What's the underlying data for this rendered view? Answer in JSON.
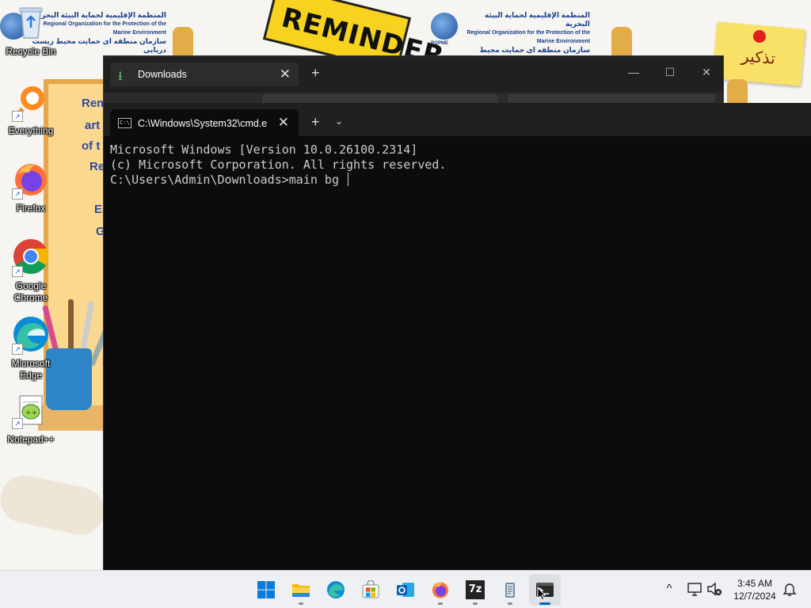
{
  "wallpaper": {
    "logo_text_line1": "المنظمة الإقليمية لحماية البيئة البحرية",
    "logo_text_line2": "Regional Organization for the Protection of the Marine Environment",
    "logo_text_line3": "سازمان منطقه ای حمایت محیط زیست دریایی",
    "logo_abbrev": "ROPME",
    "reminder_text": "REMINDER",
    "note_text": "تذكير",
    "board_lines": [
      "Rem",
      "art",
      "of t",
      "Re",
      "E",
      "G"
    ]
  },
  "desktop_icons": [
    {
      "label": "Recycle Bin",
      "icon": "recycle-bin-icon"
    },
    {
      "label": "Everything",
      "icon": "everything-search-icon"
    },
    {
      "label": "Firefox",
      "icon": "firefox-icon"
    },
    {
      "label": "Google Chrome",
      "icon": "chrome-icon"
    },
    {
      "label": "Microsoft Edge",
      "icon": "edge-icon"
    },
    {
      "label": "Notepad++",
      "icon": "notepad-plus-plus-icon"
    }
  ],
  "explorer": {
    "tab_label": "Downloads",
    "new_tab": "+",
    "minimize": "—",
    "maximize": "☐",
    "close": "✕"
  },
  "terminal": {
    "tab_label": "C:\\Windows\\System32\\cmd.e",
    "new_tab": "+",
    "dropdown": "⌄",
    "lines": [
      "Microsoft Windows [Version 10.0.26100.2314]",
      "(c) Microsoft Corporation. All rights reserved.",
      "",
      "C:\\Users\\Admin\\Downloads>main bg "
    ]
  },
  "taskbar": {
    "apps": [
      {
        "name": "Start",
        "icon": "windows-start-icon",
        "running": false
      },
      {
        "name": "File Explorer",
        "icon": "file-explorer-icon",
        "running": true
      },
      {
        "name": "Microsoft Edge",
        "icon": "edge-icon",
        "running": false
      },
      {
        "name": "Microsoft Store",
        "icon": "store-icon",
        "running": false
      },
      {
        "name": "Outlook",
        "icon": "outlook-icon",
        "running": false
      },
      {
        "name": "Firefox",
        "icon": "firefox-icon",
        "running": true
      },
      {
        "name": "7-Zip",
        "icon": "7zip-icon",
        "running": true
      },
      {
        "name": "Notepad",
        "icon": "notepad-icon",
        "running": true
      },
      {
        "name": "Terminal",
        "icon": "terminal-icon",
        "running": true,
        "active": true
      }
    ],
    "seven_zip_text": "7z",
    "tray": {
      "chevron": "^",
      "time": "3:45 AM",
      "date": "12/7/2024"
    }
  },
  "colors": {
    "terminal_bg": "#0c0c0c",
    "terminal_text": "#cccccc",
    "window_chrome": "#202020",
    "taskbar_bg": "#eef0f3",
    "accent": "#0067c0"
  }
}
